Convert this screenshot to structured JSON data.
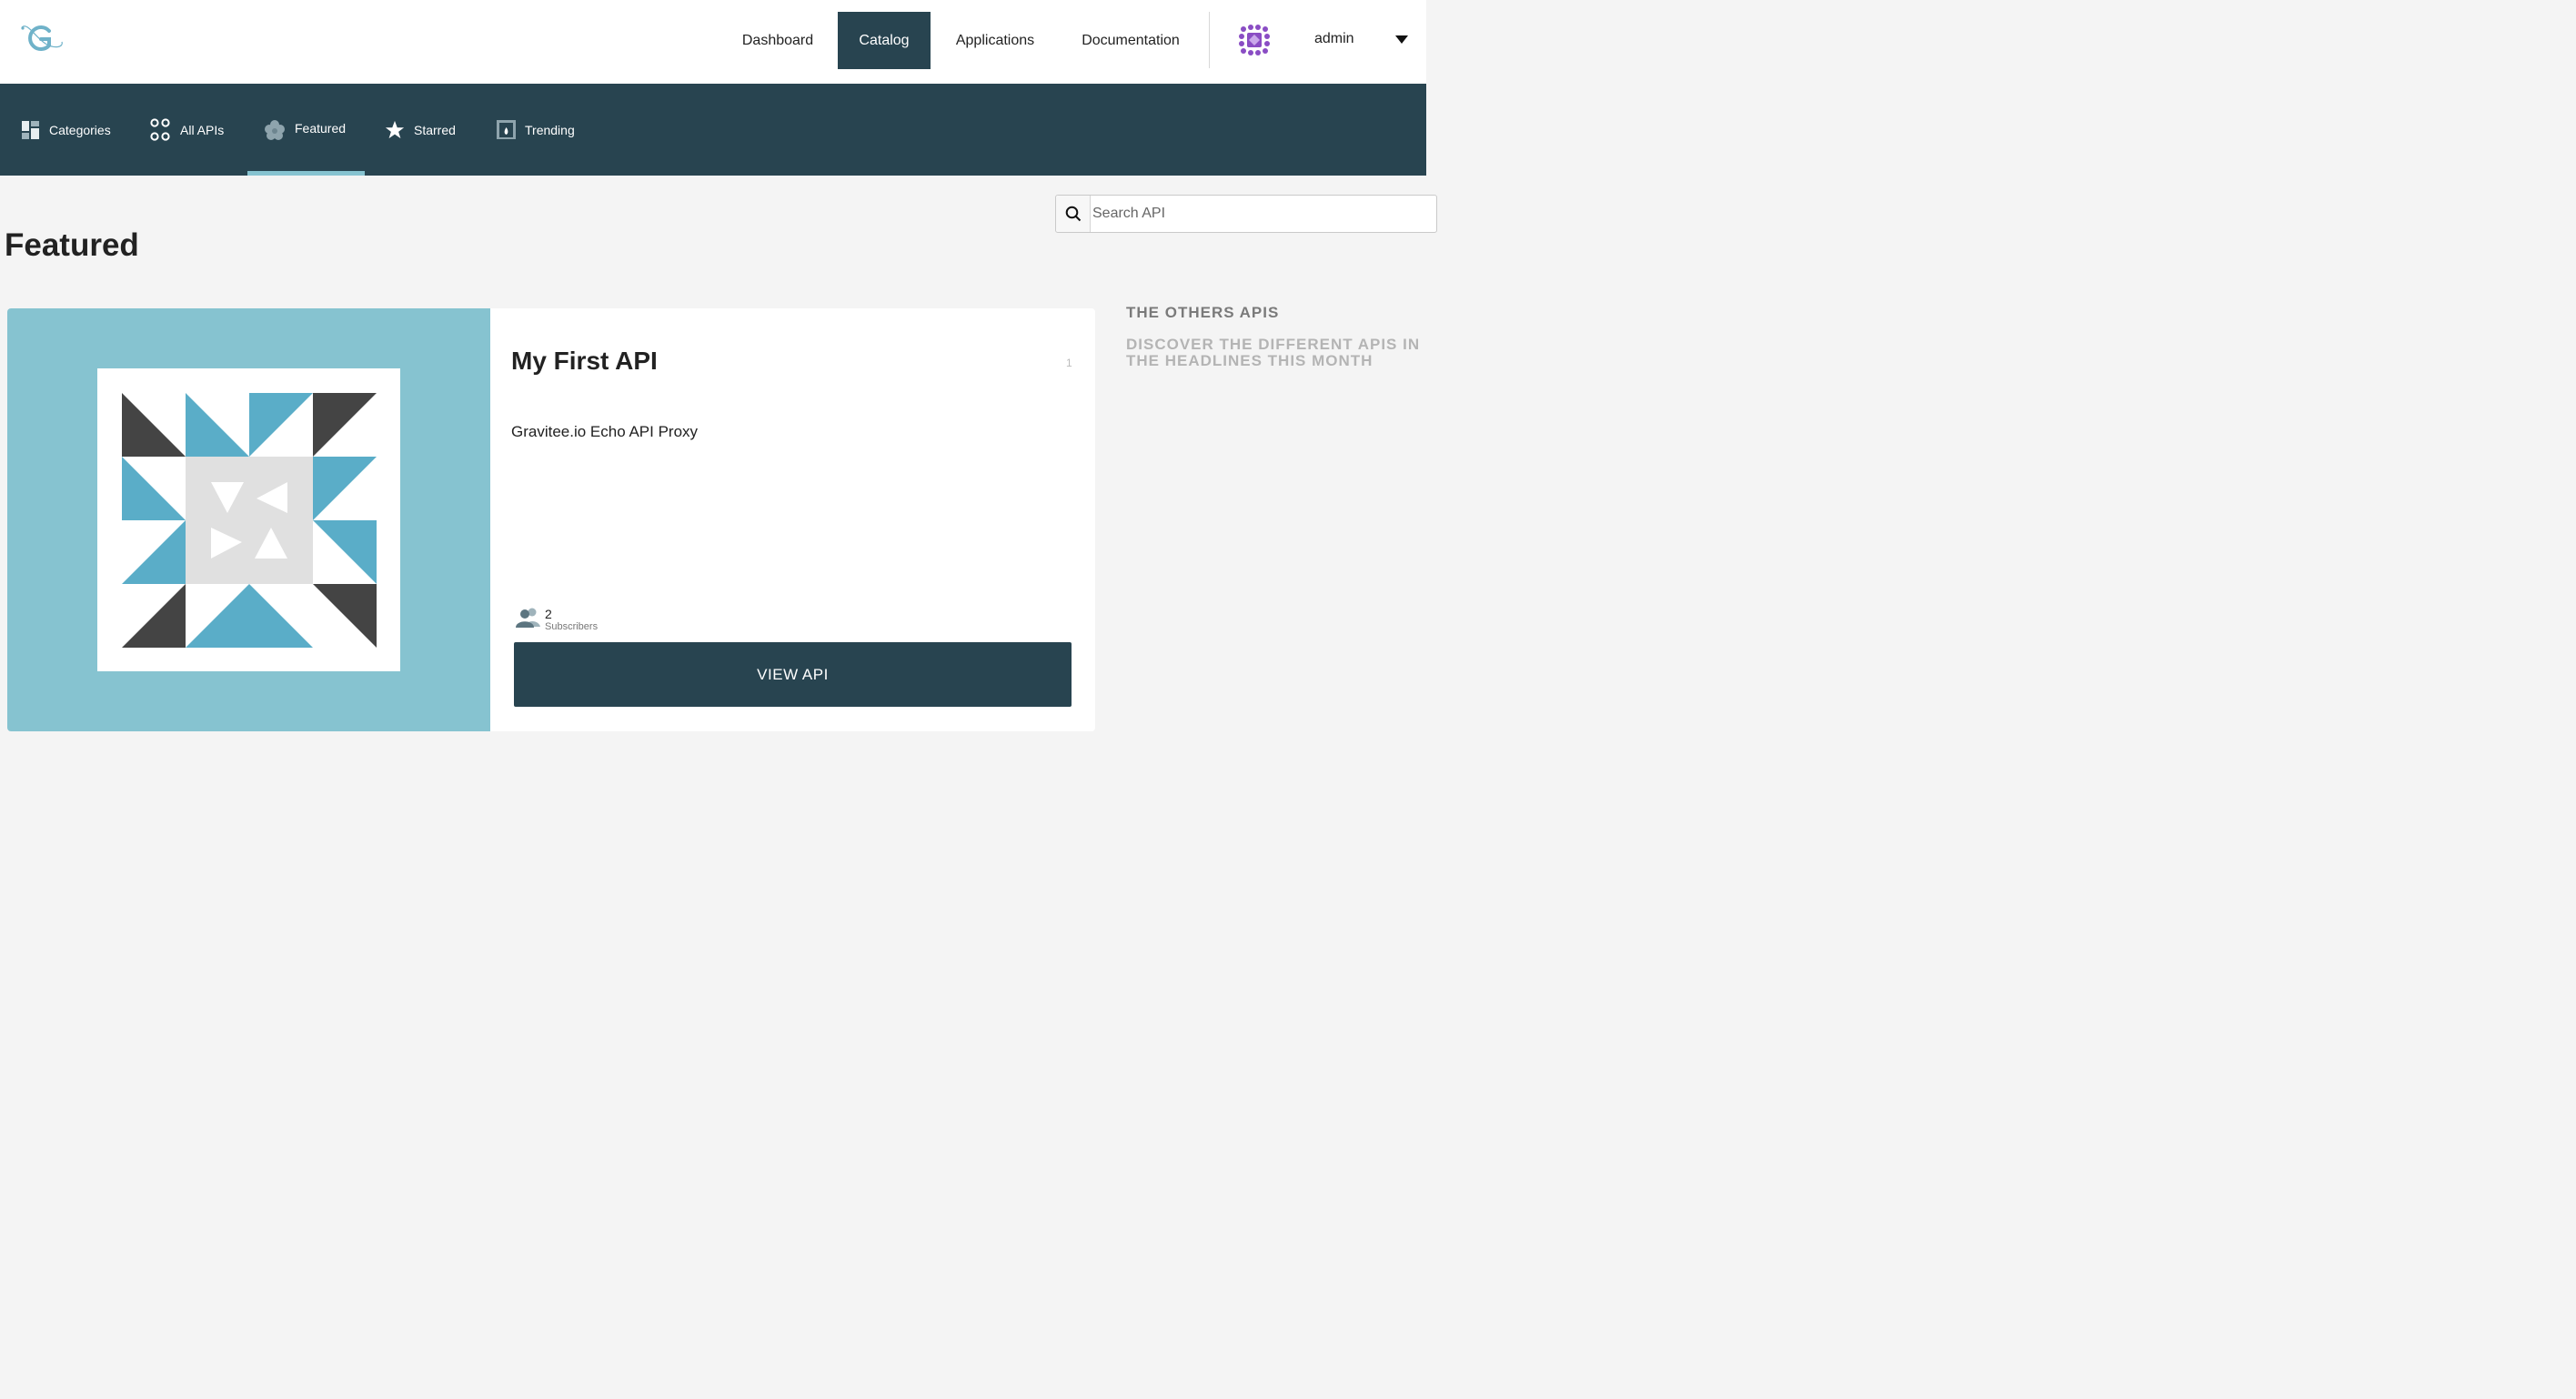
{
  "topnav": {
    "items": [
      {
        "label": "Dashboard",
        "active": false
      },
      {
        "label": "Catalog",
        "active": true
      },
      {
        "label": "Applications",
        "active": false
      },
      {
        "label": "Documentation",
        "active": false
      }
    ],
    "user": "admin"
  },
  "subnav": {
    "items": [
      {
        "label": "Categories",
        "icon": "categories-icon"
      },
      {
        "label": "All APIs",
        "icon": "all-apis-icon"
      },
      {
        "label": "Featured",
        "icon": "featured-icon",
        "active": true
      },
      {
        "label": "Starred",
        "icon": "star-icon"
      },
      {
        "label": "Trending",
        "icon": "trending-icon"
      }
    ]
  },
  "search": {
    "placeholder": "Search API",
    "value": ""
  },
  "page": {
    "title": "Featured"
  },
  "featured_api": {
    "name": "My First API",
    "version": "1",
    "description": "Gravitee.io Echo API Proxy",
    "subscribers_count": "2",
    "subscribers_label": "Subscribers",
    "view_button": "VIEW API"
  },
  "sidebar": {
    "title": "THE OTHERS APIS",
    "subtitle": "DISCOVER THE DIFFERENT APIS IN THE HEADLINES THIS MONTH"
  },
  "colors": {
    "primary": "#284450",
    "media_bg": "#86c3d0",
    "accent_blue": "#5aadc8",
    "dark_gray": "#444444",
    "avatar_purple": "#8a4dc4"
  }
}
